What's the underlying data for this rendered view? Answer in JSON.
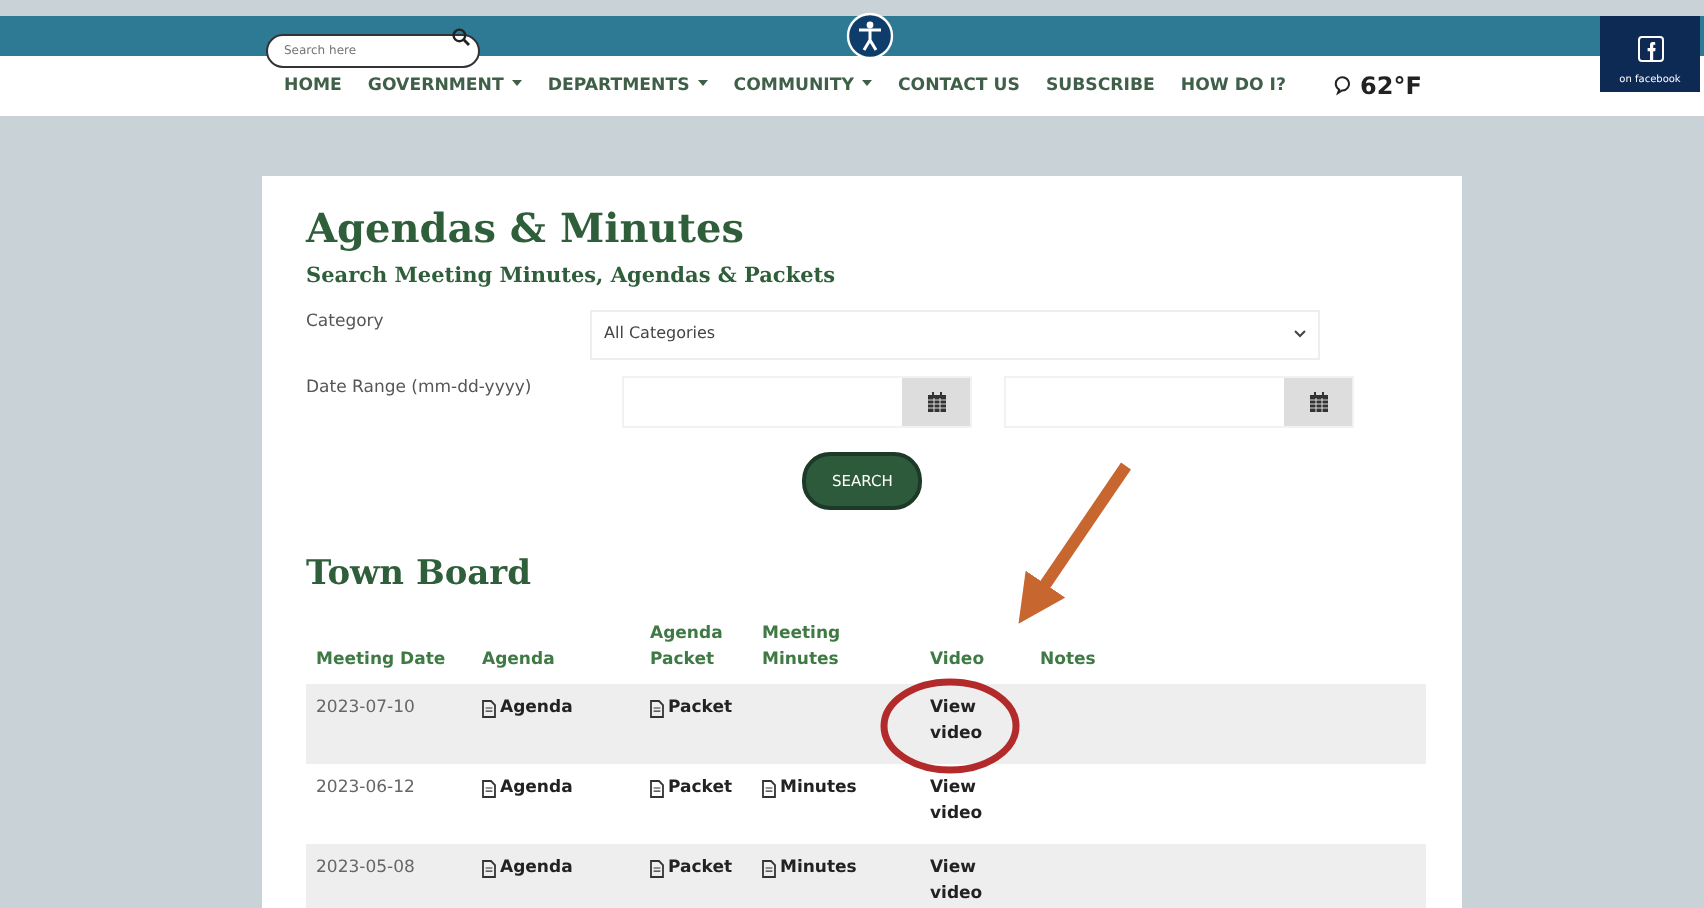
{
  "header": {
    "search": {
      "placeholder": "Search here"
    },
    "facebook": "on facebook",
    "weather": "62°F"
  },
  "nav": [
    {
      "label": "HOME",
      "dropdown": false
    },
    {
      "label": "GOVERNMENT",
      "dropdown": true
    },
    {
      "label": "DEPARTMENTS",
      "dropdown": true
    },
    {
      "label": "COMMUNITY",
      "dropdown": true
    },
    {
      "label": "CONTACT US",
      "dropdown": false
    },
    {
      "label": "SUBSCRIBE",
      "dropdown": false
    },
    {
      "label": "HOW DO I?",
      "dropdown": false
    }
  ],
  "title": "Agendas & Minutes",
  "subtitle": "Search Meeting Minutes, Agendas & Packets",
  "filters": {
    "category_label": "Category",
    "category_value": "All Categories",
    "date_label": "Date Range (mm-dd-yyyy)"
  },
  "search_button": "SEARCH",
  "section_title": "Town Board",
  "table": {
    "columns": [
      "Meeting Date",
      "Agenda",
      "Agenda Packet",
      "Meeting Minutes",
      "Video",
      "Notes"
    ],
    "rows": [
      {
        "date": "2023-07-10",
        "agenda": "Agenda",
        "packet": "Packet",
        "minutes": null,
        "video": "View video"
      },
      {
        "date": "2023-06-12",
        "agenda": "Agenda",
        "packet": "Packet",
        "minutes": "Minutes",
        "video": "View video"
      },
      {
        "date": "2023-05-08",
        "agenda": "Agenda",
        "packet": "Packet",
        "minutes": "Minutes",
        "video": "View video"
      }
    ]
  }
}
